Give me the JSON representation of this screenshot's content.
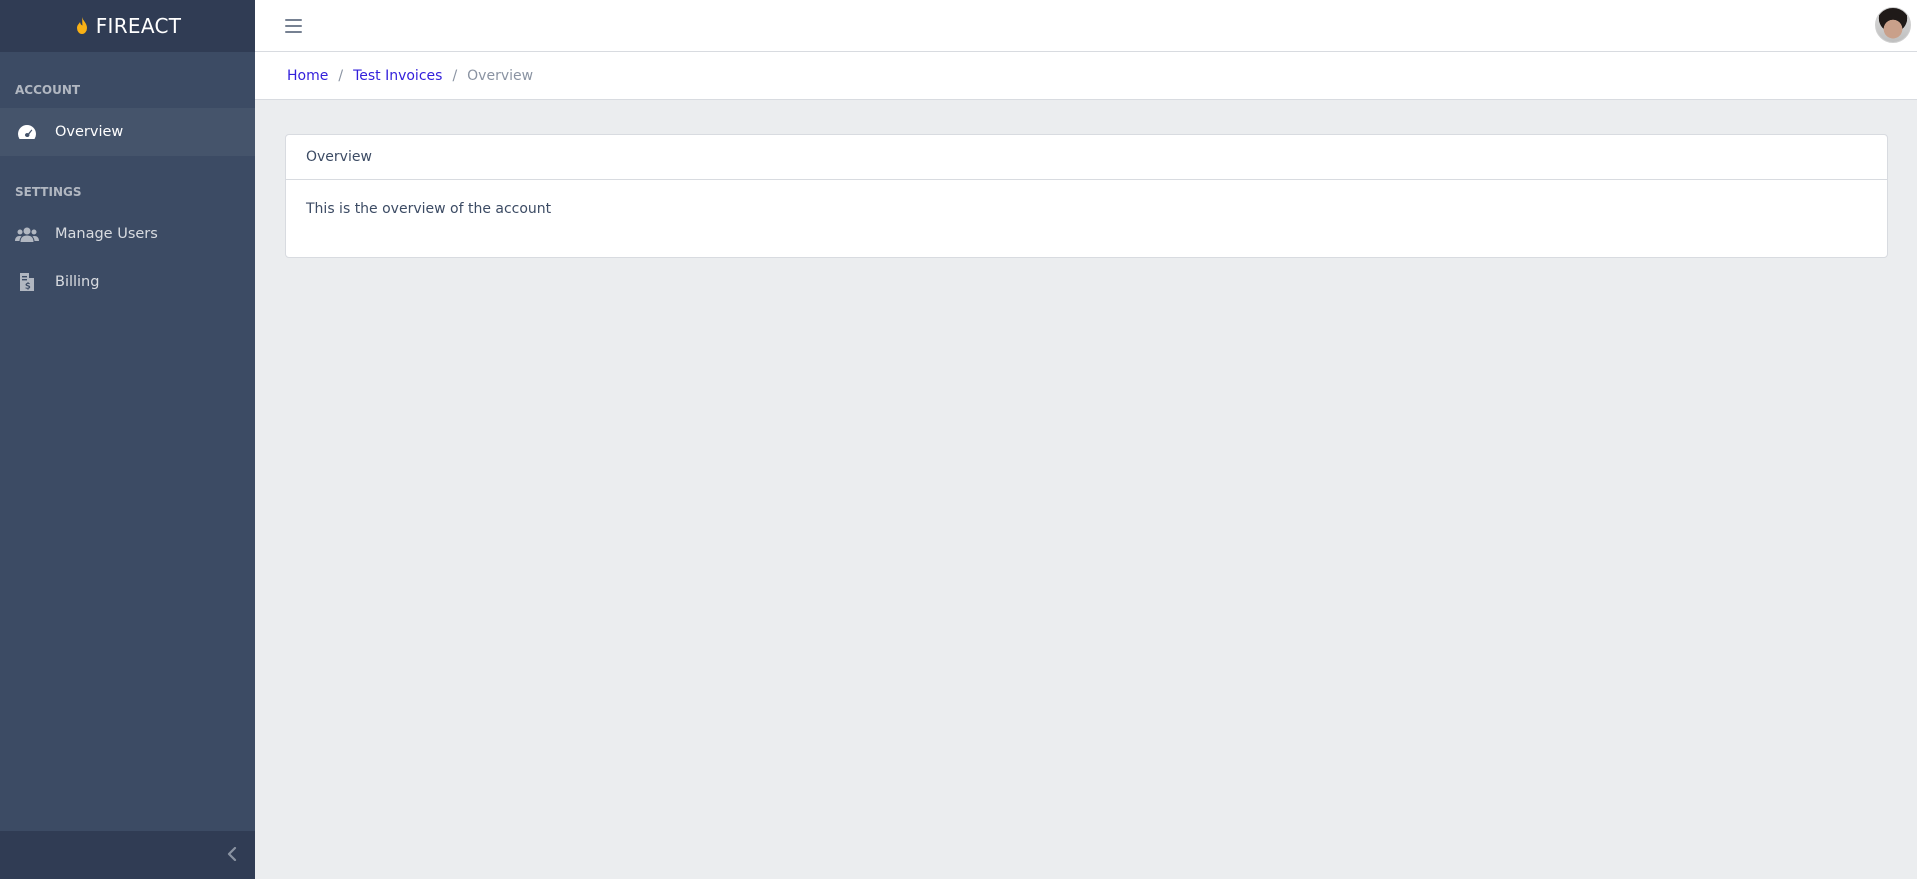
{
  "brand": {
    "name": "FIREACT"
  },
  "sidebar": {
    "sections": [
      {
        "title": "ACCOUNT"
      },
      {
        "title": "SETTINGS"
      }
    ],
    "items": [
      {
        "label": "Overview",
        "icon": "speedometer-icon",
        "active": true
      },
      {
        "label": "Manage Users",
        "icon": "users-icon"
      },
      {
        "label": "Billing",
        "icon": "invoice-icon"
      }
    ]
  },
  "breadcrumb": {
    "home": "Home",
    "account": "Test Invoices",
    "current": "Overview",
    "separator": "/"
  },
  "card": {
    "header": "Overview",
    "body": "This is the overview of the account"
  },
  "colors": {
    "sidebar_bg": "#3c4b64",
    "sidebar_dark": "#303c54",
    "link": "#321fdb",
    "page_bg": "#ebedef",
    "flame": "#f9b115"
  }
}
